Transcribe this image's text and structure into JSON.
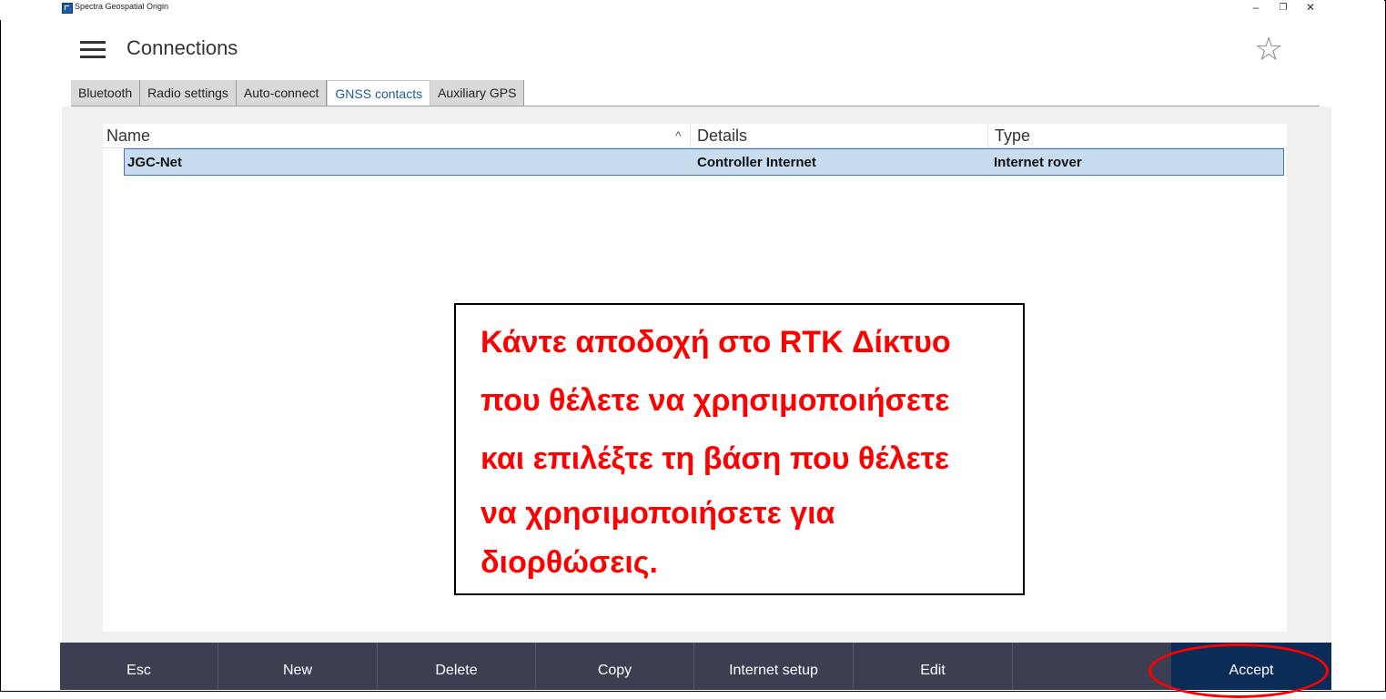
{
  "window": {
    "title": "Spectra Geospatial Origin",
    "minimize_glyph": "–",
    "maximize_glyph": "❐",
    "close_glyph": "✕"
  },
  "header": {
    "title": "Connections",
    "favorite_glyph": "☆"
  },
  "tabs": [
    {
      "label": "Bluetooth",
      "active": false
    },
    {
      "label": "Radio settings",
      "active": false
    },
    {
      "label": "Auto-connect",
      "active": false
    },
    {
      "label": "GNSS contacts",
      "active": true
    },
    {
      "label": "Auxiliary GPS",
      "active": false
    }
  ],
  "table": {
    "columns": [
      "Name",
      "Details",
      "Type"
    ],
    "sort_glyph": "^",
    "rows": [
      {
        "name": "JGC-Net",
        "details": "Controller Internet",
        "type": "Internet rover",
        "selected": true
      }
    ]
  },
  "callout": {
    "lines": [
      "Κάντε αποδοχή στο RTK Δίκτυο",
      "που θέλετε να χρησιμοποιήσετε",
      "και επιλέξτε τη βάση που θέλετε",
      "να χρησιμοποιήσετε για",
      "διορθώσεις."
    ],
    "color": "#ff0000"
  },
  "bottom_bar": {
    "buttons": [
      "Esc",
      "New",
      "Delete",
      "Copy",
      "Internet setup",
      "Edit",
      "",
      "Accept"
    ]
  },
  "colors": {
    "bottom_bar": "#3c3f51",
    "accept_button": "#0b2c57",
    "selected_row": "#c7dcee",
    "active_tab_text": "#1f5b8f",
    "highlight_ring": "#ff0000"
  }
}
